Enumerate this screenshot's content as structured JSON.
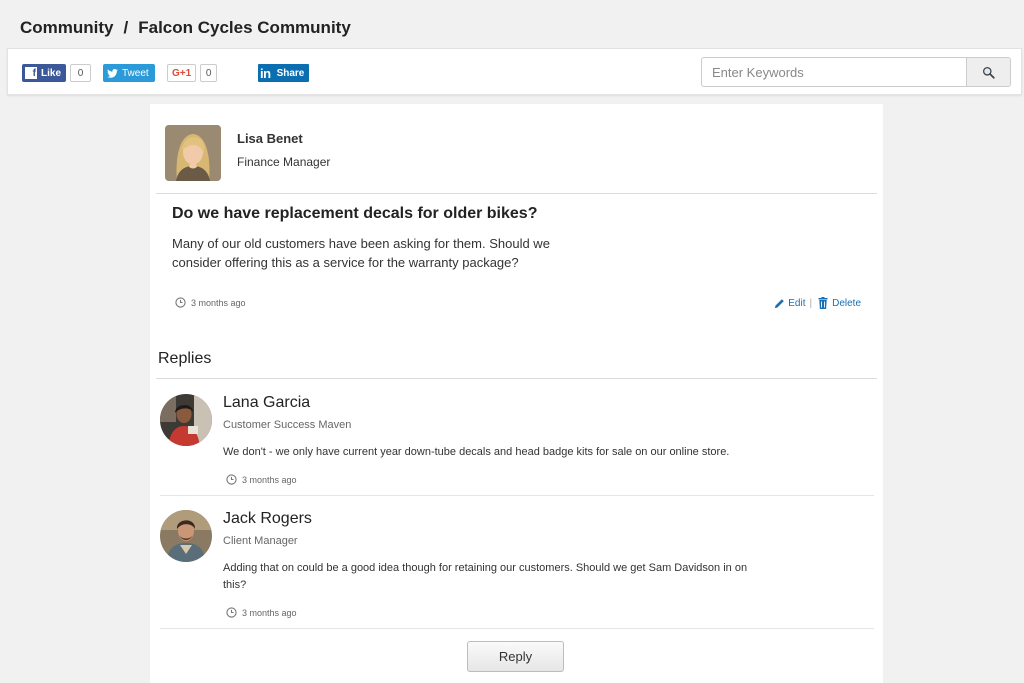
{
  "breadcrumb": {
    "root": "Community",
    "separator": "/",
    "current": "Falcon Cycles Community"
  },
  "social": {
    "facebook": {
      "label": "Like",
      "count": "0"
    },
    "twitter": {
      "label": "Tweet"
    },
    "googleplus": {
      "label": "G+1",
      "count": "0"
    },
    "linkedin": {
      "label": "Share",
      "logo": "in"
    }
  },
  "search": {
    "placeholder": "Enter Keywords",
    "value": ""
  },
  "post": {
    "author": {
      "name": "Lisa Benet",
      "role": "Finance Manager"
    },
    "title": "Do we have replacement decals for older bikes?",
    "body": "Many of our old customers have been asking for them. Should we consider offering this as a service for the warranty package?",
    "time": "3 months ago",
    "actions": {
      "edit": "Edit",
      "separator": "|",
      "delete": "Delete"
    }
  },
  "replies": {
    "title": "Replies",
    "items": [
      {
        "name": "Lana Garcia",
        "role": "Customer Success Maven",
        "text": "We don't - we only have current year down-tube decals and head badge kits for sale on our online store.",
        "time": "3 months ago"
      },
      {
        "name": "Jack Rogers",
        "role": "Client Manager",
        "text": "Adding that on could be a good idea though for retaining our customers. Should we get Sam Davidson in on this?",
        "time": "3 months ago"
      }
    ]
  },
  "reply_button": "Reply",
  "colors": {
    "link": "#1a6fb3",
    "facebook": "#3b5998",
    "twitter": "#2b9ad8",
    "googleplus": "#dd4b39",
    "linkedin": "#0b6eb0"
  }
}
